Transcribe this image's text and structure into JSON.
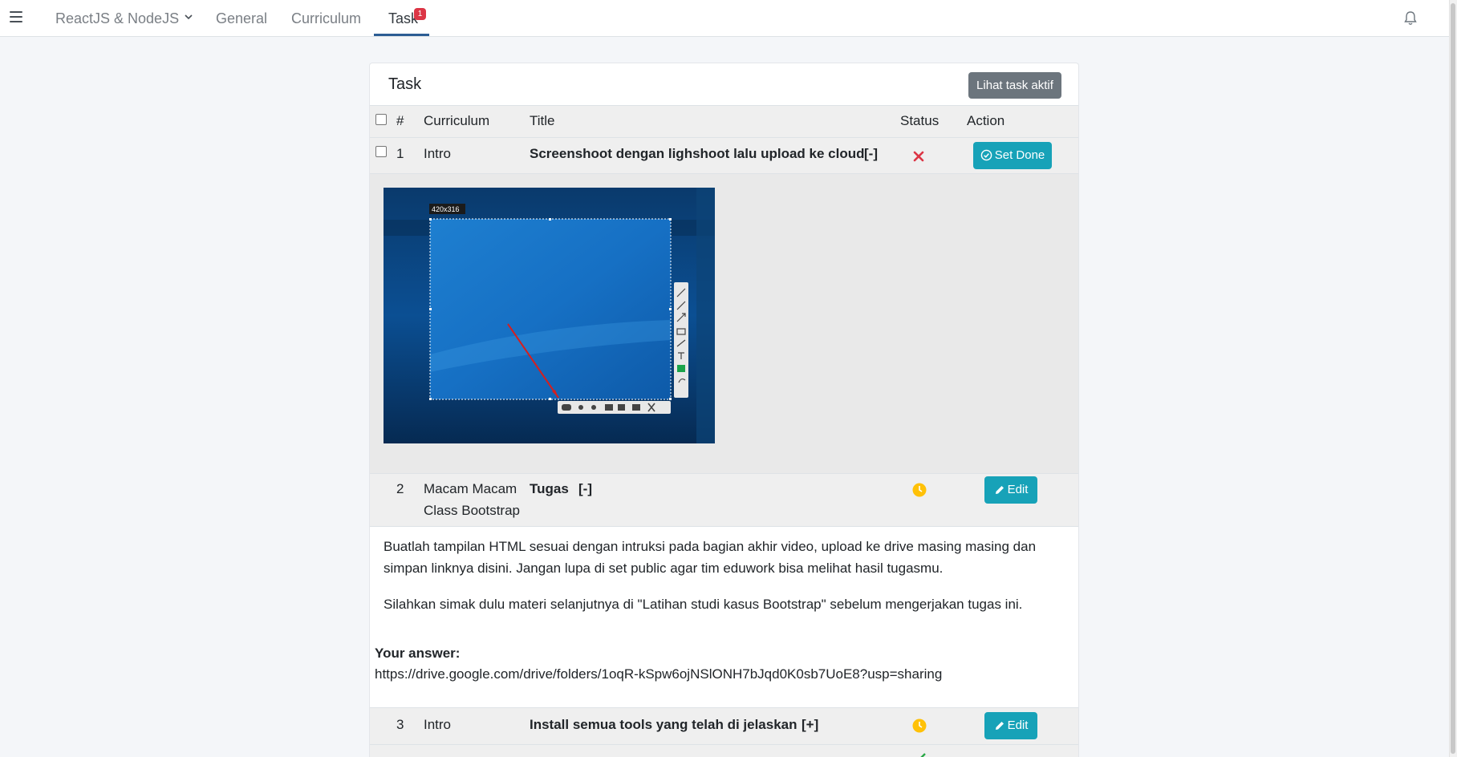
{
  "nav": {
    "course": "ReactJS & NodeJS",
    "general": "General",
    "curriculum": "Curriculum",
    "task": "Task",
    "task_badge": "1"
  },
  "card": {
    "title": "Task",
    "active_button": "Lihat task aktif"
  },
  "table": {
    "headers": {
      "number": "#",
      "curriculum": "Curriculum",
      "title": "Title",
      "status": "Status",
      "action": "Action"
    },
    "rows": [
      {
        "number": "1",
        "curriculum": "Intro",
        "title": "Screenshoot dengan lighshoot lalu upload ke cloud",
        "toggle": "[-]",
        "status_icon": "x-icon",
        "action": "Set Done"
      },
      {
        "number": "2",
        "curriculum_line1": "Macam Macam",
        "curriculum_line2": "Class Bootstrap",
        "title": "Tugas",
        "toggle": "[-]",
        "status_icon": "clock-icon",
        "action": "Edit"
      },
      {
        "number": "3",
        "curriculum": "Intro",
        "title": "Install semua tools yang telah di jelaskan",
        "toggle": "[+]",
        "status_icon": "clock-icon",
        "action": "Edit"
      }
    ]
  },
  "screenshot": {
    "size_label": "420x316"
  },
  "task2": {
    "paragraph1_line1": "Buatlah tampilan HTML sesuai dengan intruksi pada bagian akhir video, upload ke drive masing masing dan",
    "paragraph1_line2": "simpan linknya disini. Jangan lupa di set public agar tim eduwork bisa melihat hasil tugasmu.",
    "paragraph2": "Silahkan simak dulu materi selanjutnya di \"Latihan studi kasus Bootstrap\" sebelum mengerjakan tugas ini.",
    "answer_label": "Your answer:",
    "answer_value": "https://drive.google.com/drive/folders/1oqR-kSpw6ojNSlONH7bJqd0K0sb7UoE8?usp=sharing"
  },
  "colors": {
    "accent": "#17a2b8",
    "secondary": "#6c757d",
    "danger": "#dc3545",
    "warning": "#ffc107",
    "tab_underline": "#2c5d94"
  }
}
